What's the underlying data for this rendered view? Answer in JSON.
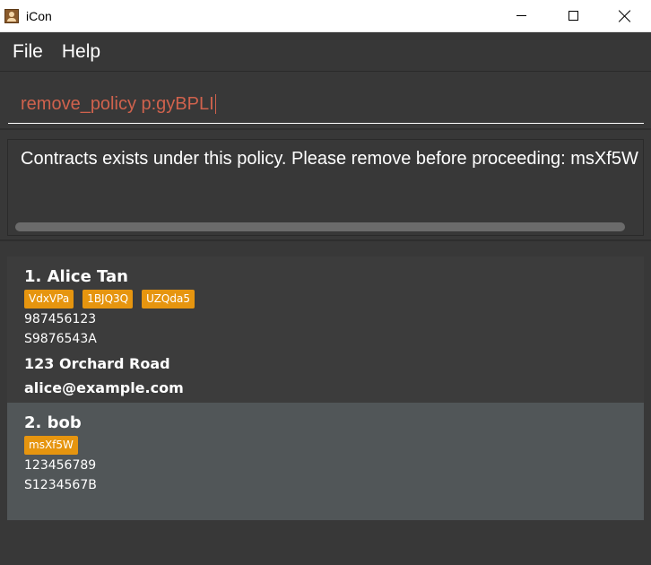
{
  "window": {
    "title": "iCon"
  },
  "menu": {
    "file_label": "File",
    "help_label": "Help"
  },
  "command": {
    "value": "remove_policy p:gyBPLI"
  },
  "result": {
    "text": "Contracts exists under this policy. Please remove before proceeding: msXf5W"
  },
  "persons": [
    {
      "name": "1. Alice Tan",
      "tags": [
        "VdxVPa",
        "1BJQ3Q",
        "UZQda5"
      ],
      "phone": "987456123",
      "nric": "S9876543A",
      "address": "123 Orchard Road",
      "email": "alice@example.com"
    },
    {
      "name": "2. bob",
      "tags": [
        "msXf5W"
      ],
      "phone": "123456789",
      "nric": "S1234567B"
    }
  ],
  "colors": {
    "background": "#383838",
    "command_text": "#d0624d",
    "tag": "#e6950f",
    "selected_card": "#515658"
  }
}
